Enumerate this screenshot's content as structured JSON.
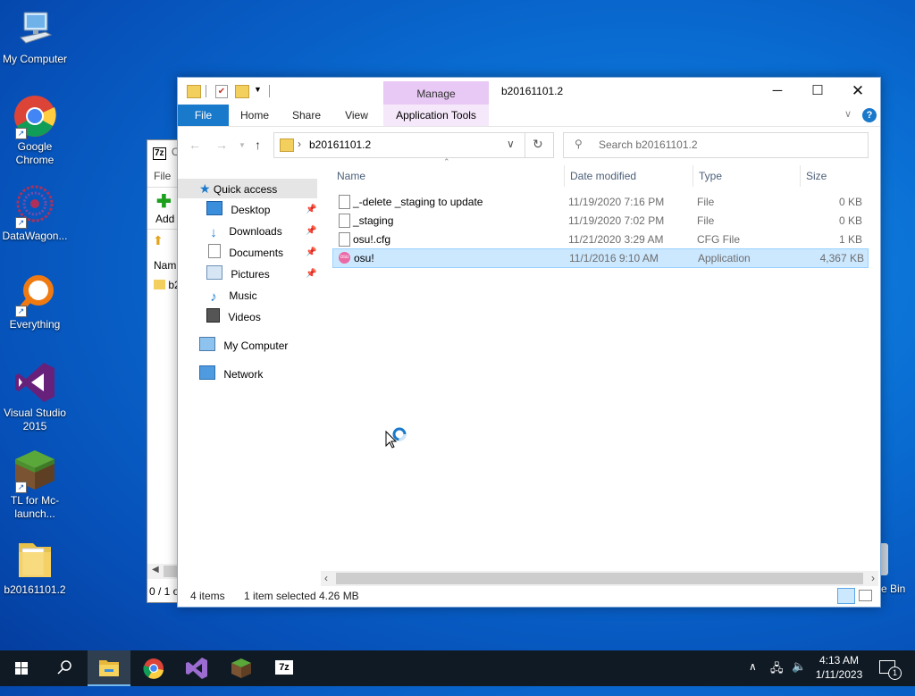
{
  "desktop": {
    "icons": [
      {
        "label": "My Computer",
        "icon": "computer-icon"
      },
      {
        "label": "Google Chrome",
        "icon": "chrome-icon"
      },
      {
        "label": "DataWagon...",
        "icon": "datawagon-icon"
      },
      {
        "label": "Everything",
        "icon": "everything-icon"
      },
      {
        "label": "Visual Studio 2015",
        "icon": "visual-studio-icon"
      },
      {
        "label": "TL for Mc-launch...",
        "icon": "minecraft-icon"
      },
      {
        "label": "b20161101.2",
        "icon": "folder-icon"
      }
    ],
    "recycle_bin_partial": "e Bin"
  },
  "bg_window": {
    "title_icon": "7z",
    "title_partial": "C",
    "menu_partial": "File",
    "toolbar_add": "Add",
    "col_partial": "Nam",
    "row_partial": "b2",
    "status_partial": "0 / 1 o"
  },
  "explorer": {
    "title": "b20161101.2",
    "manage_tab": "Manage",
    "tabs": [
      "File",
      "Home",
      "Share",
      "View"
    ],
    "app_tools_tab": "Application Tools",
    "address": "b20161101.2",
    "search_placeholder": "Search b20161101.2",
    "sidebar": {
      "quick_access": "Quick access",
      "items": [
        "Desktop",
        "Downloads",
        "Documents",
        "Pictures",
        "Music",
        "Videos"
      ],
      "my_computer": "My Computer",
      "network": "Network"
    },
    "columns": [
      "Name",
      "Date modified",
      "Type",
      "Size"
    ],
    "files": [
      {
        "name": "_-delete _staging to update",
        "date": "11/19/2020 7:16 PM",
        "type": "File",
        "size": "0 KB",
        "selected": false
      },
      {
        "name": "_staging",
        "date": "11/19/2020 7:02 PM",
        "type": "File",
        "size": "0 KB",
        "selected": false
      },
      {
        "name": "osu!.cfg",
        "date": "11/21/2020 3:29 AM",
        "type": "CFG File",
        "size": "1 KB",
        "selected": false
      },
      {
        "name": "osu!",
        "date": "11/1/2016 9:10 AM",
        "type": "Application",
        "size": "4,367 KB",
        "selected": true
      }
    ],
    "status": {
      "items": "4 items",
      "selected": "1 item selected",
      "size": "4.26 MB"
    }
  },
  "taskbar": {
    "clock_time": "4:13 AM",
    "clock_date": "1/11/2023",
    "notification_count": "1"
  },
  "colors": {
    "accent": "#1979ca",
    "selection": "#cce8ff",
    "manage_tab": "#e8c8f4",
    "taskbar": "#101a24"
  }
}
